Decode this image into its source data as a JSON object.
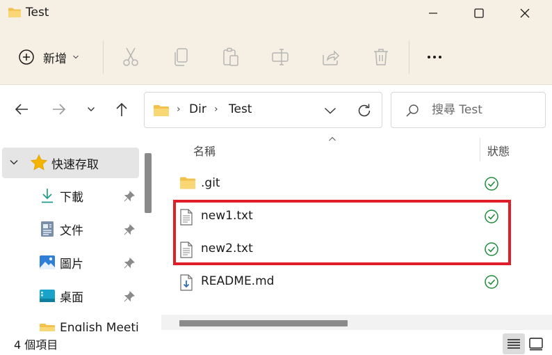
{
  "window": {
    "title": "Test",
    "icon": "folder-icon",
    "controls": [
      "minimize-icon",
      "maximize-icon",
      "close-icon"
    ]
  },
  "commandbar": {
    "new_label": "新增",
    "actions": [
      "cut-icon",
      "copy-icon",
      "paste-icon",
      "rename-icon",
      "share-icon",
      "delete-icon"
    ],
    "more": "more-icon"
  },
  "navigation": {
    "buttons": [
      "back-icon",
      "forward-icon",
      "recent-dropdown-icon",
      "up-icon"
    ],
    "breadcrumb": [
      "Dir",
      "Test"
    ],
    "search_placeholder": "搜尋 Test"
  },
  "sidebar": {
    "items": [
      {
        "label": "快速存取",
        "icon": "star-icon",
        "expanded": true,
        "selected": true
      },
      {
        "label": "下載",
        "icon": "download-icon",
        "pinned": true
      },
      {
        "label": "文件",
        "icon": "document-icon",
        "pinned": true
      },
      {
        "label": "圖片",
        "icon": "pictures-icon",
        "pinned": true
      },
      {
        "label": "桌面",
        "icon": "desktop-icon",
        "pinned": true
      },
      {
        "label": "English Meeti",
        "icon": "folder-icon",
        "pinned": false
      }
    ]
  },
  "file_list": {
    "columns": {
      "name": "名稱",
      "status": "狀態"
    },
    "sort": "ascending",
    "rows": [
      {
        "name": ".git",
        "type": "folder",
        "status": "synced",
        "highlighted": false
      },
      {
        "name": "new1.txt",
        "type": "text",
        "status": "synced",
        "highlighted": true
      },
      {
        "name": "new2.txt",
        "type": "text",
        "status": "synced",
        "highlighted": true
      },
      {
        "name": "README.md",
        "type": "markdown",
        "status": "synced",
        "highlighted": false
      }
    ]
  },
  "statusbar": {
    "item_count": "4 個項目",
    "views": [
      "details-view-icon",
      "tiles-view-icon"
    ],
    "active_view": "details"
  },
  "colors": {
    "chrome_bg": "#f6efe3",
    "highlight": "#e01e2a",
    "status_ok": "#1e8c3a",
    "folder": "#f2c14e",
    "selection": "#e5e5e5"
  }
}
